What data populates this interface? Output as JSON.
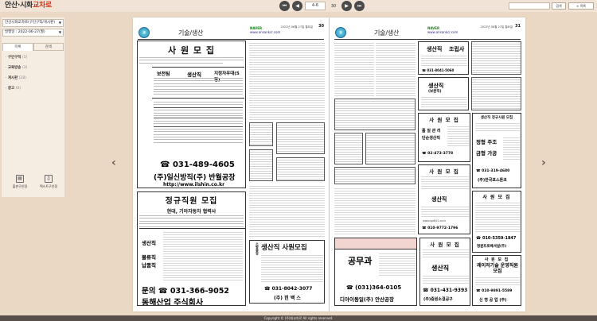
{
  "brand": {
    "main": "안산·시화",
    "accent": "교차로"
  },
  "pager": {
    "current": "4-6",
    "total": "30"
  },
  "toolbar": {
    "search_label": "검색",
    "list_label": "목록"
  },
  "sidebar": {
    "edition": "안산시화교차로(구인구직/게시판)",
    "issue_date": "발행일 : 2022-06-27(월)",
    "tabs": [
      "목록",
      "검색"
    ],
    "categories": [
      {
        "label": "구인구직",
        "count": "(1)"
      },
      {
        "label": "교육방송",
        "count": "(3)"
      },
      {
        "label": "게시판",
        "count": "(28)"
      },
      {
        "label": "광고",
        "count": "(0)"
      }
    ],
    "tools": [
      "출판구인정",
      "텍스트구인정"
    ]
  },
  "left_page": {
    "section": "기술/생산",
    "naver": "NAVER",
    "site": "www.ansankcr.com",
    "issue": "2022년 06월 27일 월요일",
    "page_no": "30",
    "ad1": {
      "title": "사 원 모 집",
      "rows": [
        "보전팀",
        "생산직",
        "지정자우대(5명)"
      ],
      "phone": "☎ 031-489-4605",
      "company": "(주)일신방직(주) 반월공장",
      "url": "http://www.ilshin.co.kr"
    },
    "ad2": {
      "title": "정규직원 모집",
      "subtitle": "현대, 기아자동차 협력사",
      "jobs": [
        "생산직",
        "물류직",
        "납품직"
      ],
      "contact": "문의 ☎ 031-366-9052",
      "company": "동해산업 주식회사"
    },
    "ad3": {
      "title": "생산직 사원모집",
      "side": "소방중앙",
      "phone": "☎ 031-8042-3077",
      "company": "(주) 힌 백 스"
    }
  },
  "right_page": {
    "section": "기술/생산",
    "naver": "NAVER",
    "site": "www.ansankcr.com",
    "issue": "2022년 06월 27일 월요일",
    "page_no": "31",
    "ad_r1": {
      "title": "생산직",
      "subtitle": "조립사",
      "phone": "☎ 031-8041-5060"
    },
    "ad_r2": {
      "title": "생산직",
      "subtitle": "(보분직)"
    },
    "ad_r3": {
      "title": "사 원 모 집",
      "job1": "품 질 관 리",
      "job2": "단순생산직",
      "phone": "☎ 02-473-3778"
    },
    "ad_r4": {
      "title": "생산직 정규사원 모집",
      "job1": "정형 주조",
      "job2": "금형 가공",
      "phone": "☎ 031-319-4680",
      "company": "(주)한국포스톤코"
    },
    "ad_r5": {
      "title": "사 원 모 집",
      "job": "생산직",
      "site": "www.ngdk21.co.kr",
      "phone": "☎ 010-9772-1796"
    },
    "ad_r6": {
      "title": "사 원 모 집",
      "phone": "☎ 010-5359-1847",
      "company": "명원프로페셔널(주)"
    },
    "ad_r7": {
      "title": "공무과",
      "phone": "☎ (031)364-0105",
      "company": "디아이동일(주) 안산공장"
    },
    "ad_r8": {
      "title": "사 원 모 집",
      "job": "생산직",
      "phone": "☎ 031-431-9393",
      "company": "(주)중원소결공구"
    },
    "ad_r9": {
      "title": "사 원 모 집",
      "job": "레이저기술 운영직원 모집",
      "phone": "☎ 010-9891-5589",
      "company": "신 명 공 업 (주)"
    }
  },
  "copyright": "Copyright © (주)대교차로 All rights reserved."
}
